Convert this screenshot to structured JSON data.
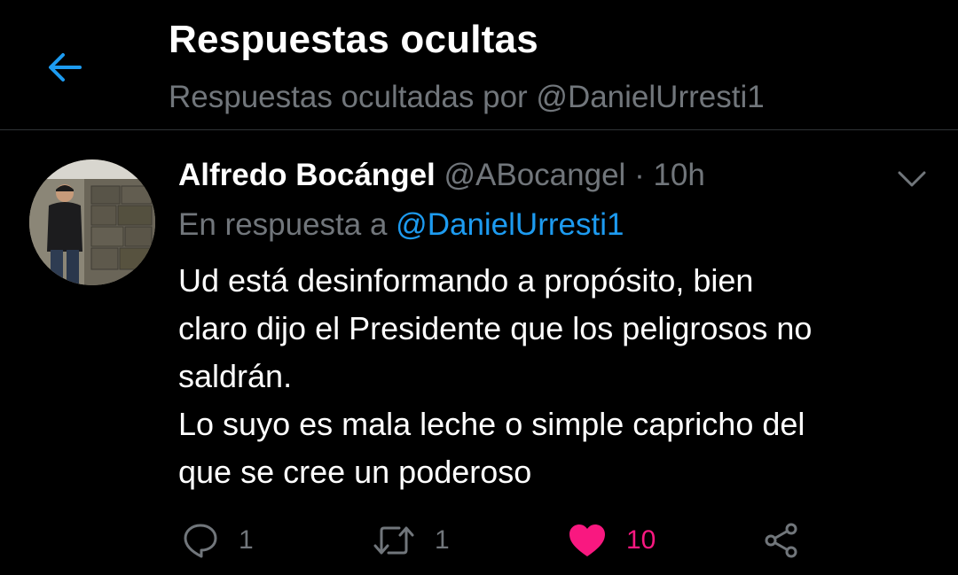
{
  "header": {
    "title": "Respuestas ocultas",
    "subtitle": "Respuestas ocultadas por @DanielUrresti1",
    "back_icon": "arrow-left-icon"
  },
  "tweet": {
    "author_name": "Alfredo Bocángel",
    "author_handle": "@ABocangel",
    "separator": "·",
    "timestamp": "10h",
    "reply_prefix": "En respuesta a",
    "reply_mention": "@DanielUrresti1",
    "body_lines": [
      "Ud está desinformando a propósito, bien",
      "claro dijo el Presidente que los peligrosos no",
      "saldrán.",
      "Lo suyo es mala leche o simple capricho del",
      "que se cree un poderoso"
    ],
    "actions": {
      "reply_count": "1",
      "retweet_count": "1",
      "like_count": "10"
    }
  },
  "colors": {
    "background": "#000000",
    "accent": "#1d9bf0",
    "muted": "#71767b",
    "like": "#f91880",
    "divider": "#2f3336"
  }
}
